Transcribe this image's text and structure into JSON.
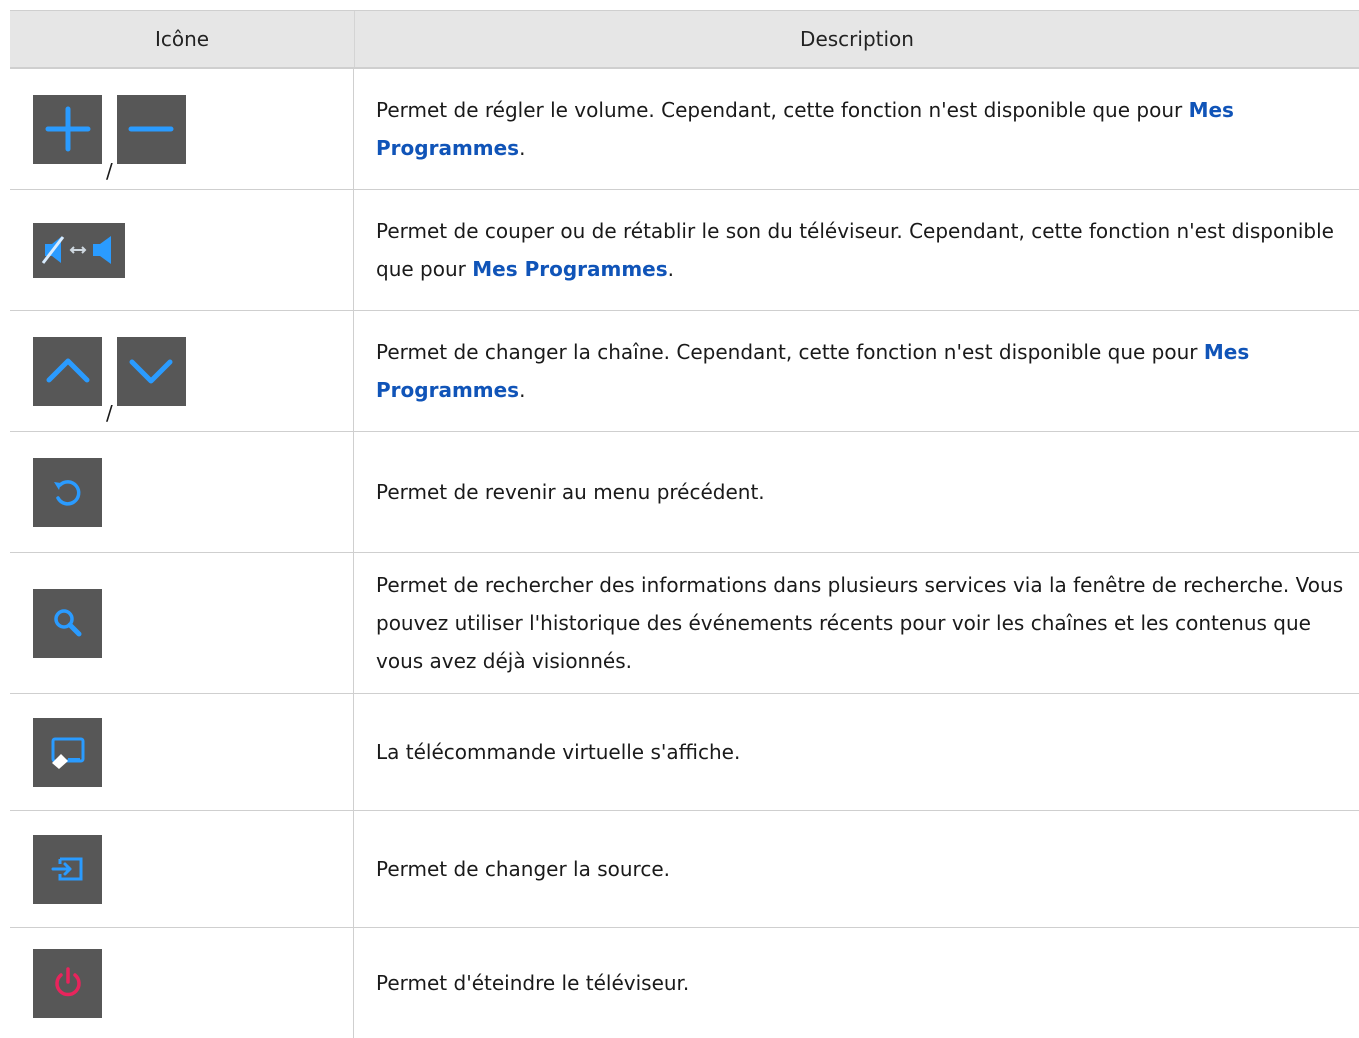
{
  "header": {
    "icon_col": "Icône",
    "desc_col": "Description"
  },
  "separator": "/",
  "rows": [
    {
      "icons": [
        "plus-icon",
        "minus-icon"
      ],
      "text": "Permet de régler le volume. Cependant, cette fonction n'est disponible que pour ",
      "bold": "Mes Programmes",
      "tail": "."
    },
    {
      "icons": [
        "mute-toggle-icon"
      ],
      "text": "Permet de couper ou de rétablir le son du téléviseur. Cependant, cette fonction n'est disponible que pour ",
      "bold": "Mes Programmes",
      "tail": "."
    },
    {
      "icons": [
        "chevron-up-icon",
        "chevron-down-icon"
      ],
      "text": "Permet de changer la chaîne. Cependant, cette fonction n'est disponible que pour ",
      "bold": "Mes Programmes",
      "tail": "."
    },
    {
      "icons": [
        "return-icon"
      ],
      "text": "Permet de revenir au menu précédent."
    },
    {
      "icons": [
        "search-icon"
      ],
      "text": "Permet de rechercher des informations dans plusieurs services via la fenêtre de recherche. Vous pouvez utiliser l'historique des événements récents pour voir les chaînes et les contenus que vous avez déjà visionnés."
    },
    {
      "icons": [
        "virtual-remote-icon"
      ],
      "text": "La télécommande virtuelle s'affiche."
    },
    {
      "icons": [
        "source-icon"
      ],
      "text": "Permet de changer la source."
    },
    {
      "icons": [
        "power-icon"
      ],
      "text": "Permet d'éteindre le téléviseur."
    }
  ],
  "colors": {
    "icon_bg": "#575757",
    "icon_blue": "#1e8fff",
    "power_red": "#e8245c",
    "link_bold": "#1054b8"
  }
}
